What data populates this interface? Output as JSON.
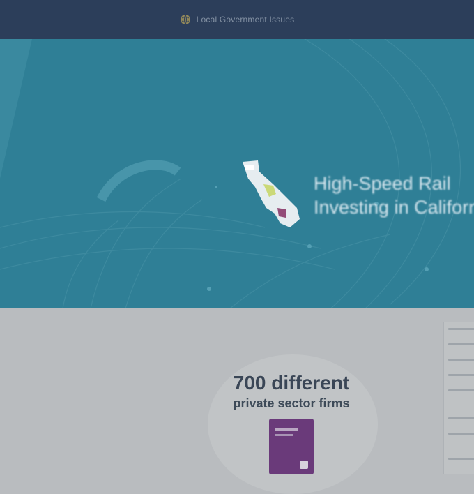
{
  "topbar": {
    "text": "Local Government Issues",
    "icon": "globe-icon"
  },
  "hero": {
    "title_line1": "High-Speed Rail",
    "title_line2": "Investing in California"
  },
  "feature": {
    "title": "700 different",
    "subtitle": "private sector firms"
  },
  "colors": {
    "topbar_bg": "#2c3e5a",
    "hero_bg": "#2f7f96",
    "lower_bg": "#b9bcbf",
    "product_purple": "#6a3a7a"
  }
}
